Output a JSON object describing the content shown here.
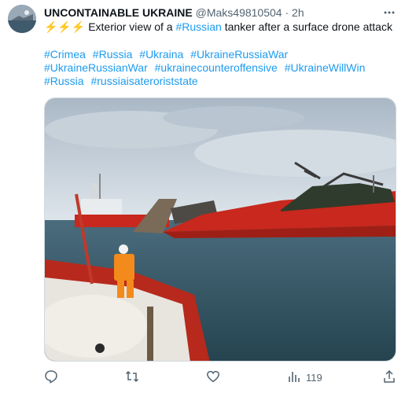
{
  "author": {
    "display_name": "UNCONTAINABLE UKRAINE",
    "handle": "@Maks49810504",
    "separator": "·",
    "time": "2h"
  },
  "tweet": {
    "emoji": "⚡⚡⚡",
    "text_before": "Exterior view of a ",
    "link": "#Russian",
    "text_after": " tanker after a surface drone attack",
    "hashtags": [
      "#Crimea",
      "#Russia",
      "#Ukraina",
      "#UkraineRussiaWar",
      "#UkraineRussianWar",
      "#ukrainecounteroffensive",
      "#UkraineWillWin",
      "#Russia",
      "#russiaisateroriststate"
    ]
  },
  "actions": {
    "views": "119"
  },
  "icons": {
    "more": "more-icon",
    "reply": "reply-icon",
    "retweet": "retweet-icon",
    "like": "like-icon",
    "views": "views-icon",
    "share": "share-icon"
  },
  "colors": {
    "link": "#1d9bf0",
    "muted": "#536471",
    "tanker_hull": "#c8281d"
  }
}
